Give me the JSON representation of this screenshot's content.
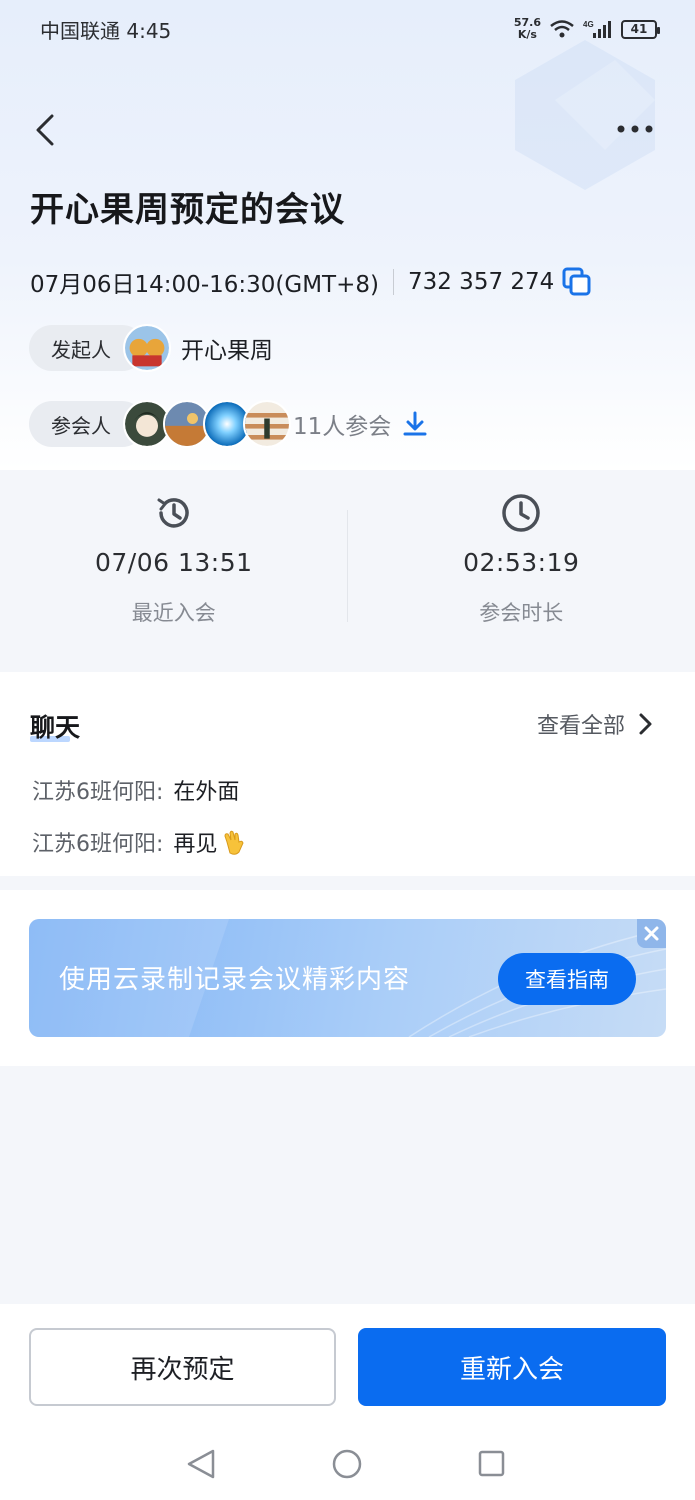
{
  "status_bar": {
    "carrier_time": "中国联通 4:45",
    "net_speed_value": "57.6",
    "net_speed_unit": "K/s",
    "battery": "41"
  },
  "meeting": {
    "title": "开心果周预定的会议",
    "datetime": "07月06日14:00-16:30(GMT+8)",
    "meeting_id": "732 357 274"
  },
  "host": {
    "label": "发起人",
    "name": "开心果周"
  },
  "participants": {
    "label": "参会人",
    "count_text": "11人参会"
  },
  "stats": {
    "last_join": {
      "value": "07/06 13:51",
      "label": "最近入会"
    },
    "duration": {
      "value": "02:53:19",
      "label": "参会时长"
    }
  },
  "chat": {
    "title": "聊天",
    "view_all": "查看全部",
    "messages": [
      {
        "sender": "江苏6班何阳:",
        "text": "在外面"
      },
      {
        "sender": "江苏6班何阳:",
        "text": "再见"
      }
    ]
  },
  "banner": {
    "text": "使用云录制记录会议精彩内容",
    "button": "查看指南"
  },
  "actions": {
    "schedule_again": "再次预定",
    "rejoin": "重新入会"
  },
  "colors": {
    "primary": "#0a6cf0",
    "copy_icon": "#1a73e8"
  }
}
